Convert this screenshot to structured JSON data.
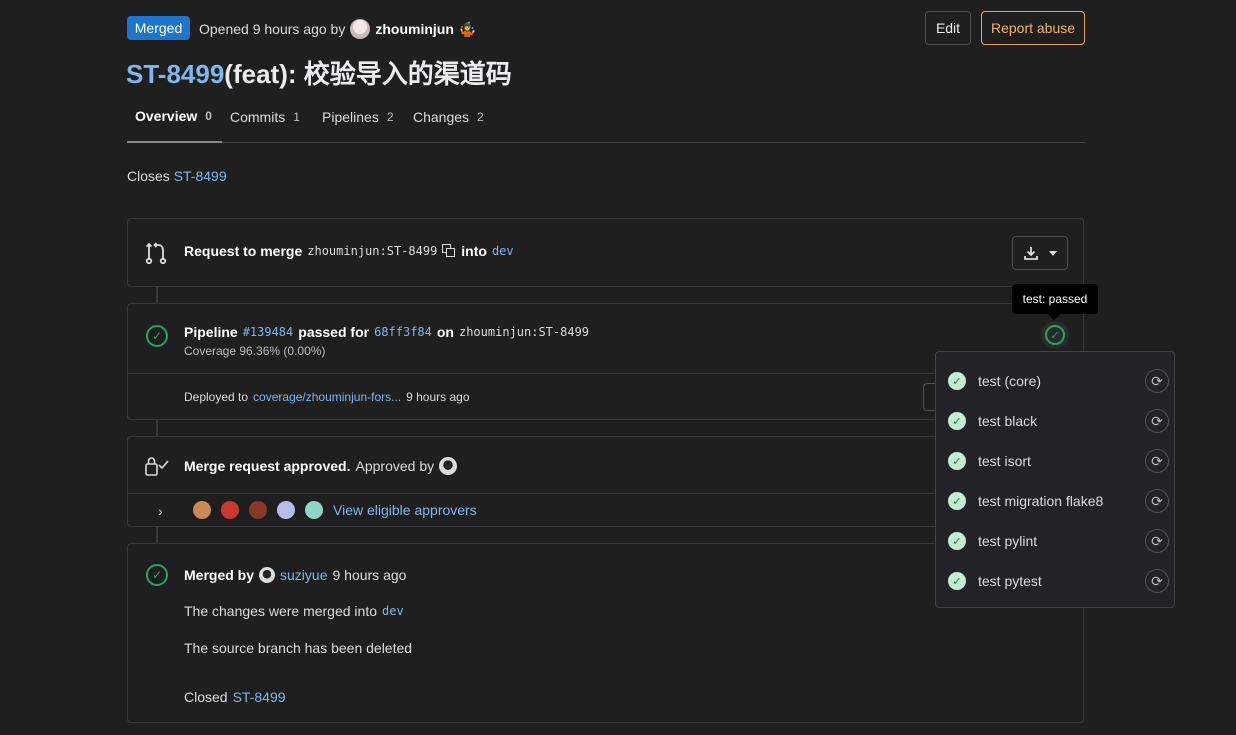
{
  "header": {
    "status_badge": "Merged",
    "opened_text": "Opened 9 hours ago by",
    "author": "zhouminjun",
    "author_emoji": "🤹",
    "edit_label": "Edit",
    "report_label": "Report abuse"
  },
  "title": {
    "ref": "ST-8499",
    "text": "(feat): 校验导入的渠道码"
  },
  "tabs": [
    {
      "label": "Overview",
      "count": "0"
    },
    {
      "label": "Commits",
      "count": "1"
    },
    {
      "label": "Pipelines",
      "count": "2"
    },
    {
      "label": "Changes",
      "count": "2"
    }
  ],
  "description": {
    "prefix": "Closes",
    "ref": "ST-8499"
  },
  "merge_request": {
    "label": "Request to merge",
    "source_branch": "zhouminjun:ST-8499",
    "into": "into",
    "target_branch": "dev"
  },
  "pipeline": {
    "label": "Pipeline",
    "id": "#139484",
    "passed_for": "passed for",
    "commit": "68ff3f84",
    "on": "on",
    "branch": "zhouminjun:ST-8499",
    "coverage": "Coverage 96.36% (0.00%)",
    "deployed_prefix": "Deployed to",
    "deployed_env": "coverage/zhouminjun-fors...",
    "deployed_time": "9 hours ago"
  },
  "approval": {
    "label": "Merge request approved.",
    "approved_by": "Approved by",
    "view_approvers": "View eligible approvers"
  },
  "merged": {
    "label": "Merged by",
    "user": "suziyue",
    "time": "9 hours ago",
    "merged_into_text": "The changes were merged into",
    "merged_into_branch": "dev",
    "source_deleted": "The source branch has been deleted",
    "closed_prefix": "Closed",
    "closed_ref": "ST-8499"
  },
  "tooltip": "test: passed",
  "jobs": [
    "test (core)",
    "test black",
    "test isort",
    "test migration flake8",
    "test pylint",
    "test pytest"
  ],
  "colors": {
    "badge": "#1f75cb",
    "link": "#7fb6ed",
    "success": "#2da160",
    "abuse": "#f3b46b"
  }
}
